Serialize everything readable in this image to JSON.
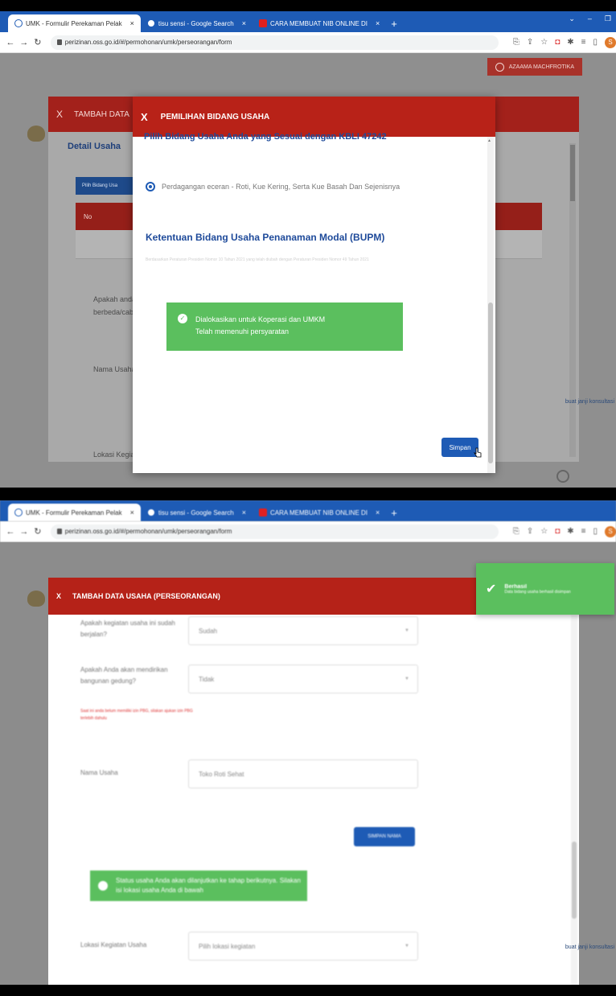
{
  "browser": {
    "tabs": [
      {
        "label": "UMK - Formulir Perekaman Pelak",
        "icon": "globe-icon"
      },
      {
        "label": "tisu sensi - Google Search",
        "icon": "google-icon"
      },
      {
        "label": "CARA MEMBUAT NIB ONLINE DI",
        "icon": "youtube-icon"
      }
    ],
    "new_tab": "+",
    "url": "perizinan.oss.go.id/#/permohonan/umk/perseorangan/form",
    "profile_initial": "S"
  },
  "header": {
    "user_name": "AZAAMA MACHFROTIKA"
  },
  "back_modal": {
    "close": "X",
    "title": "TAMBAH DATA",
    "section_title": "Detail Usaha",
    "pick_button": "Pilih Bidang Usa",
    "table_col_no": "No",
    "question_partial": "Apakah anda berbeda/cab",
    "name_label": "Nama Usaha",
    "location_label": "Lokasi Kegia"
  },
  "front_modal": {
    "close": "X",
    "title": "PEMILIHAN BIDANG USAHA",
    "cut_heading": "Pilih Bidang Usaha Anda yang Sesuai dengan KBLI 47242",
    "radio_label": "Perdagangan eceran - Roti, Kue Kering, Serta Kue Basah Dan Sejenisnya",
    "bupm_title": "Ketentuan Bidang Usaha Penanaman Modal (BUPM)",
    "bupm_note": "Berdasarkan Peraturan Presiden Nomor 10 Tahun 2021 yang telah diubah dengan Peraturan Presiden Nomor 49 Tahun 2021",
    "alert_line1": "Dialokasikan untuk Koperasi dan UMKM",
    "alert_line2": "Telah memenuhi persyaratan",
    "save_button": "Simpan"
  },
  "side_help": "buat janji konsultasi",
  "modal2": {
    "close": "X",
    "title": "TAMBAH DATA USAHA (PERSEORANGAN)",
    "q1": "Apakah kegiatan usaha ini sudah berjalan?",
    "q1_value": "Sudah",
    "q2": "Apakah Anda akan mendirikan bangunan gedung?",
    "q2_value": "Tidak",
    "q2_hint": "Saat ini anda belum memiliki izin PBG, silakan ajukan izin PBG terlebih dahulu",
    "name_label": "Nama Usaha",
    "name_value": "Toko Roti Sehat",
    "save_button": "SIMPAN NAMA",
    "alert": "Status usaha Anda akan dilanjutkan ke tahap berikutnya. Silakan isi lokasi usaha Anda di bawah",
    "location_label": "Lokasi Kegiatan Usaha",
    "location_placeholder": "Pilih lokasi kegiatan"
  },
  "toast": {
    "title": "Berhasil",
    "message": "Data bidang usaha berhasil disimpan"
  },
  "colors": {
    "brand_red": "#b82218",
    "primary_blue": "#1e5bb5",
    "success_green": "#5bbf5e"
  }
}
